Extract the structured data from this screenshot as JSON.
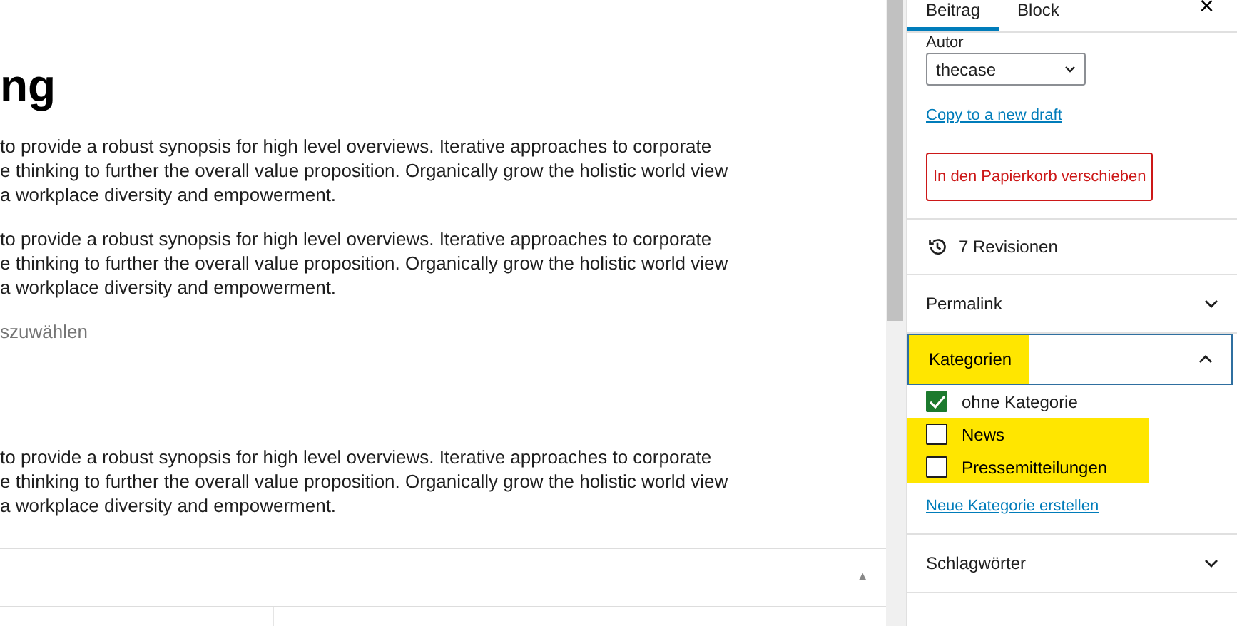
{
  "editor": {
    "heading": "ng",
    "blocks": [
      {
        "kind": "paragraph",
        "lines": [
          "to provide a robust synopsis for high level overviews. Iterative approaches to corporate",
          "e thinking to further the overall value proposition. Organically grow the holistic world view",
          "a workplace diversity and empowerment."
        ]
      },
      {
        "kind": "paragraph",
        "lines": [
          "to provide a robust synopsis for high level overviews. Iterative approaches to corporate",
          "e thinking to further the overall value proposition. Organically grow the holistic world view",
          "a workplace diversity and empowerment."
        ]
      },
      {
        "kind": "placeholder",
        "lines": [
          "szuwählen"
        ]
      },
      {
        "kind": "spacer"
      },
      {
        "kind": "paragraph",
        "lines": [
          "to provide a robust synopsis for high level overviews. Iterative approaches to corporate",
          "e thinking to further the overall value proposition. Organically grow the holistic world view",
          "a workplace diversity and empowerment."
        ]
      }
    ],
    "bottom_panel": {
      "toggle": "▲"
    }
  },
  "sidebar": {
    "tabs": [
      {
        "label": "Beitrag",
        "selected": true
      },
      {
        "label": "Block",
        "selected": false
      }
    ],
    "close": "×",
    "author": {
      "label": "Autor",
      "value": "thecase"
    },
    "copy_link": "Copy to a new draft",
    "trash_button": "In den Papierkorb verschieben",
    "revisions": "7 Revisionen",
    "panels": [
      {
        "title": "Permalink",
        "expanded": false,
        "highlighted": false
      },
      {
        "title": "Kategorien",
        "expanded": true,
        "highlighted": true,
        "categories": [
          {
            "label": "ohne Kategorie",
            "checked": true,
            "highlighted": false
          },
          {
            "label": "News",
            "checked": false,
            "highlighted": true
          },
          {
            "label": "Pressemitteilungen",
            "checked": false,
            "highlighted": true
          }
        ],
        "link": "Neue Kategorie erstellen"
      },
      {
        "title": "Schlagwörter",
        "expanded": false,
        "highlighted": false
      }
    ]
  }
}
